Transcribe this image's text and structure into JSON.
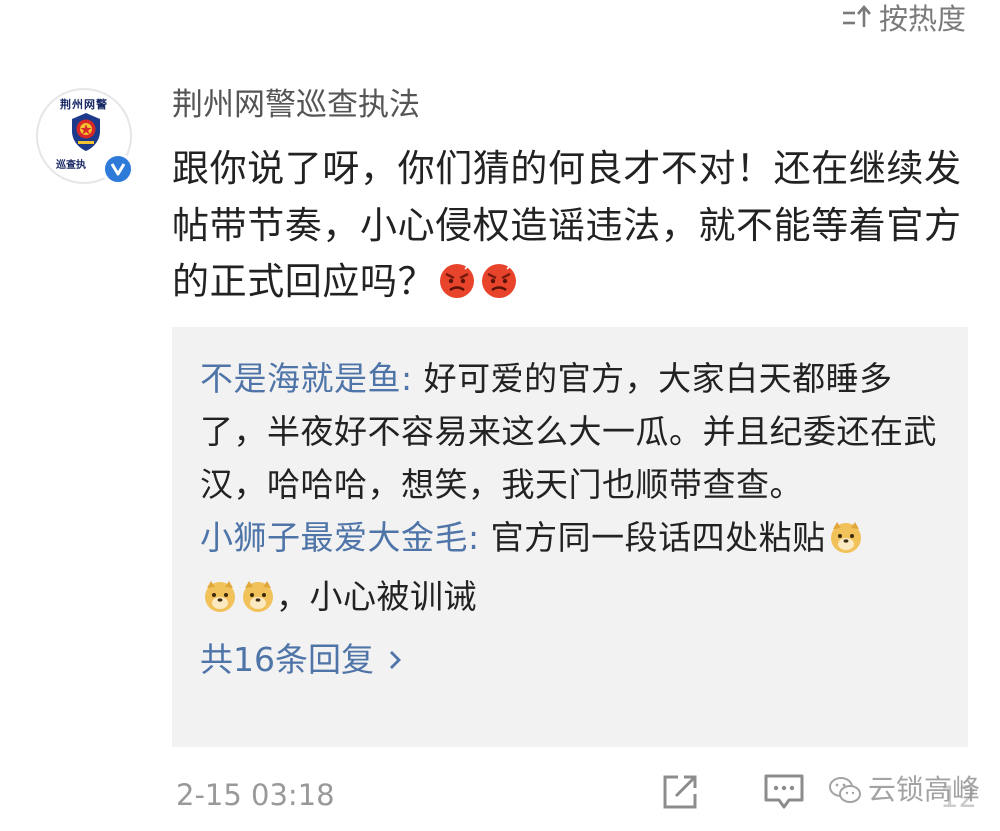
{
  "sort": {
    "label": "按热度",
    "icon": "sort-icon"
  },
  "author": {
    "name": "荆州网警巡查执法",
    "avatar_top_text": "荆州网警",
    "avatar_bottom_text": "巡查执",
    "verified": true,
    "verified_color": "#2e7ad9"
  },
  "comment": {
    "text": "跟你说了呀，你们猜的何良才不对！还在继续发帖带节奏，小心侵权造谣违法，就不能等着官方的正式回应吗？",
    "emojis": [
      "angry-face-emoji",
      "angry-face-emoji"
    ]
  },
  "replies": [
    {
      "user": "不是海就是鱼",
      "separator": ":",
      "text": " 好可爱的官方，大家白天都睡多了，半夜好不容易来这么大一瓜。并且纪委还在武汉，哈哈哈，想笑，我天门也顺带查查。"
    },
    {
      "user": "小狮子最爱大金毛",
      "separator": ":",
      "text": " 官方同一段话四处粘贴",
      "trailing_text": "，小心被训诫",
      "emojis": [
        "doge-emoji",
        "doge-emoji",
        "doge-emoji"
      ]
    }
  ],
  "reply_more": {
    "label": "共16条回复",
    "icon": "chevron-right-icon"
  },
  "footer": {
    "timestamp": "2-15 03:18",
    "share_icon": "share-icon",
    "comment_icon": "comment-icon",
    "count": "12",
    "watermark": "云锁高峰"
  },
  "colors": {
    "link_blue": "#4f74a8",
    "reply_bg": "#f2f2f2",
    "muted_text": "#999999"
  }
}
